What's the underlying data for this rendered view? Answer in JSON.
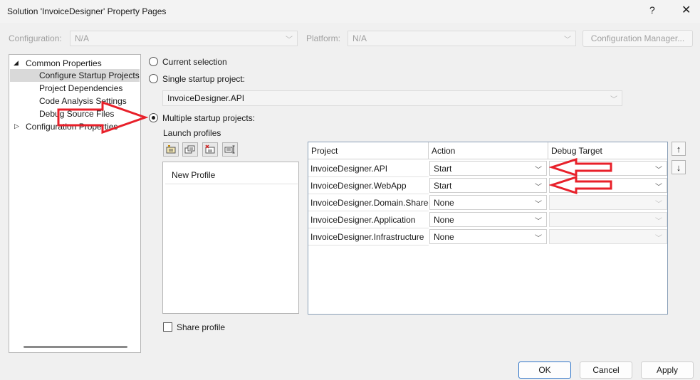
{
  "window": {
    "title": "Solution 'InvoiceDesigner' Property Pages",
    "help_glyph": "?",
    "close_glyph": "✕"
  },
  "toolbar": {
    "configuration_label": "Configuration:",
    "configuration_value": "N/A",
    "platform_label": "Platform:",
    "platform_value": "N/A",
    "config_manager_label": "Configuration Manager..."
  },
  "tree": {
    "items": [
      {
        "label": "Common Properties",
        "expander": "◢"
      },
      {
        "label": "Configure Startup Projects"
      },
      {
        "label": "Project Dependencies"
      },
      {
        "label": "Code Analysis Settings"
      },
      {
        "label": "Debug Source Files"
      },
      {
        "label": "Configuration Properties",
        "expander": "▷"
      }
    ]
  },
  "startup": {
    "current_selection_label": "Current selection",
    "single_label": "Single startup project:",
    "single_value": "InvoiceDesigner.API",
    "multiple_label": "Multiple startup projects:",
    "selected_option": "multiple"
  },
  "launch_profiles": {
    "label": "Launch profiles",
    "profiles": [
      "New Profile"
    ],
    "share_label": "Share profile"
  },
  "grid": {
    "columns": [
      "Project",
      "Action",
      "Debug Target"
    ],
    "rows": [
      {
        "project": "InvoiceDesigner.API",
        "action": "Start",
        "debug_target": ""
      },
      {
        "project": "InvoiceDesigner.WebApp",
        "action": "Start",
        "debug_target": ""
      },
      {
        "project": "InvoiceDesigner.Domain.Shared",
        "action": "None",
        "debug_target": ""
      },
      {
        "project": "InvoiceDesigner.Application",
        "action": "None",
        "debug_target": ""
      },
      {
        "project": "InvoiceDesigner.Infrastructure",
        "action": "None",
        "debug_target": ""
      }
    ]
  },
  "reorder": {
    "up_glyph": "↑",
    "down_glyph": "↓"
  },
  "footer": {
    "ok_label": "OK",
    "cancel_label": "Cancel",
    "apply_label": "Apply"
  },
  "colors": {
    "annotation_arrow": "#e8202a",
    "selection_background": "#d9d9d9",
    "primary_button_border": "#2f74c8"
  }
}
